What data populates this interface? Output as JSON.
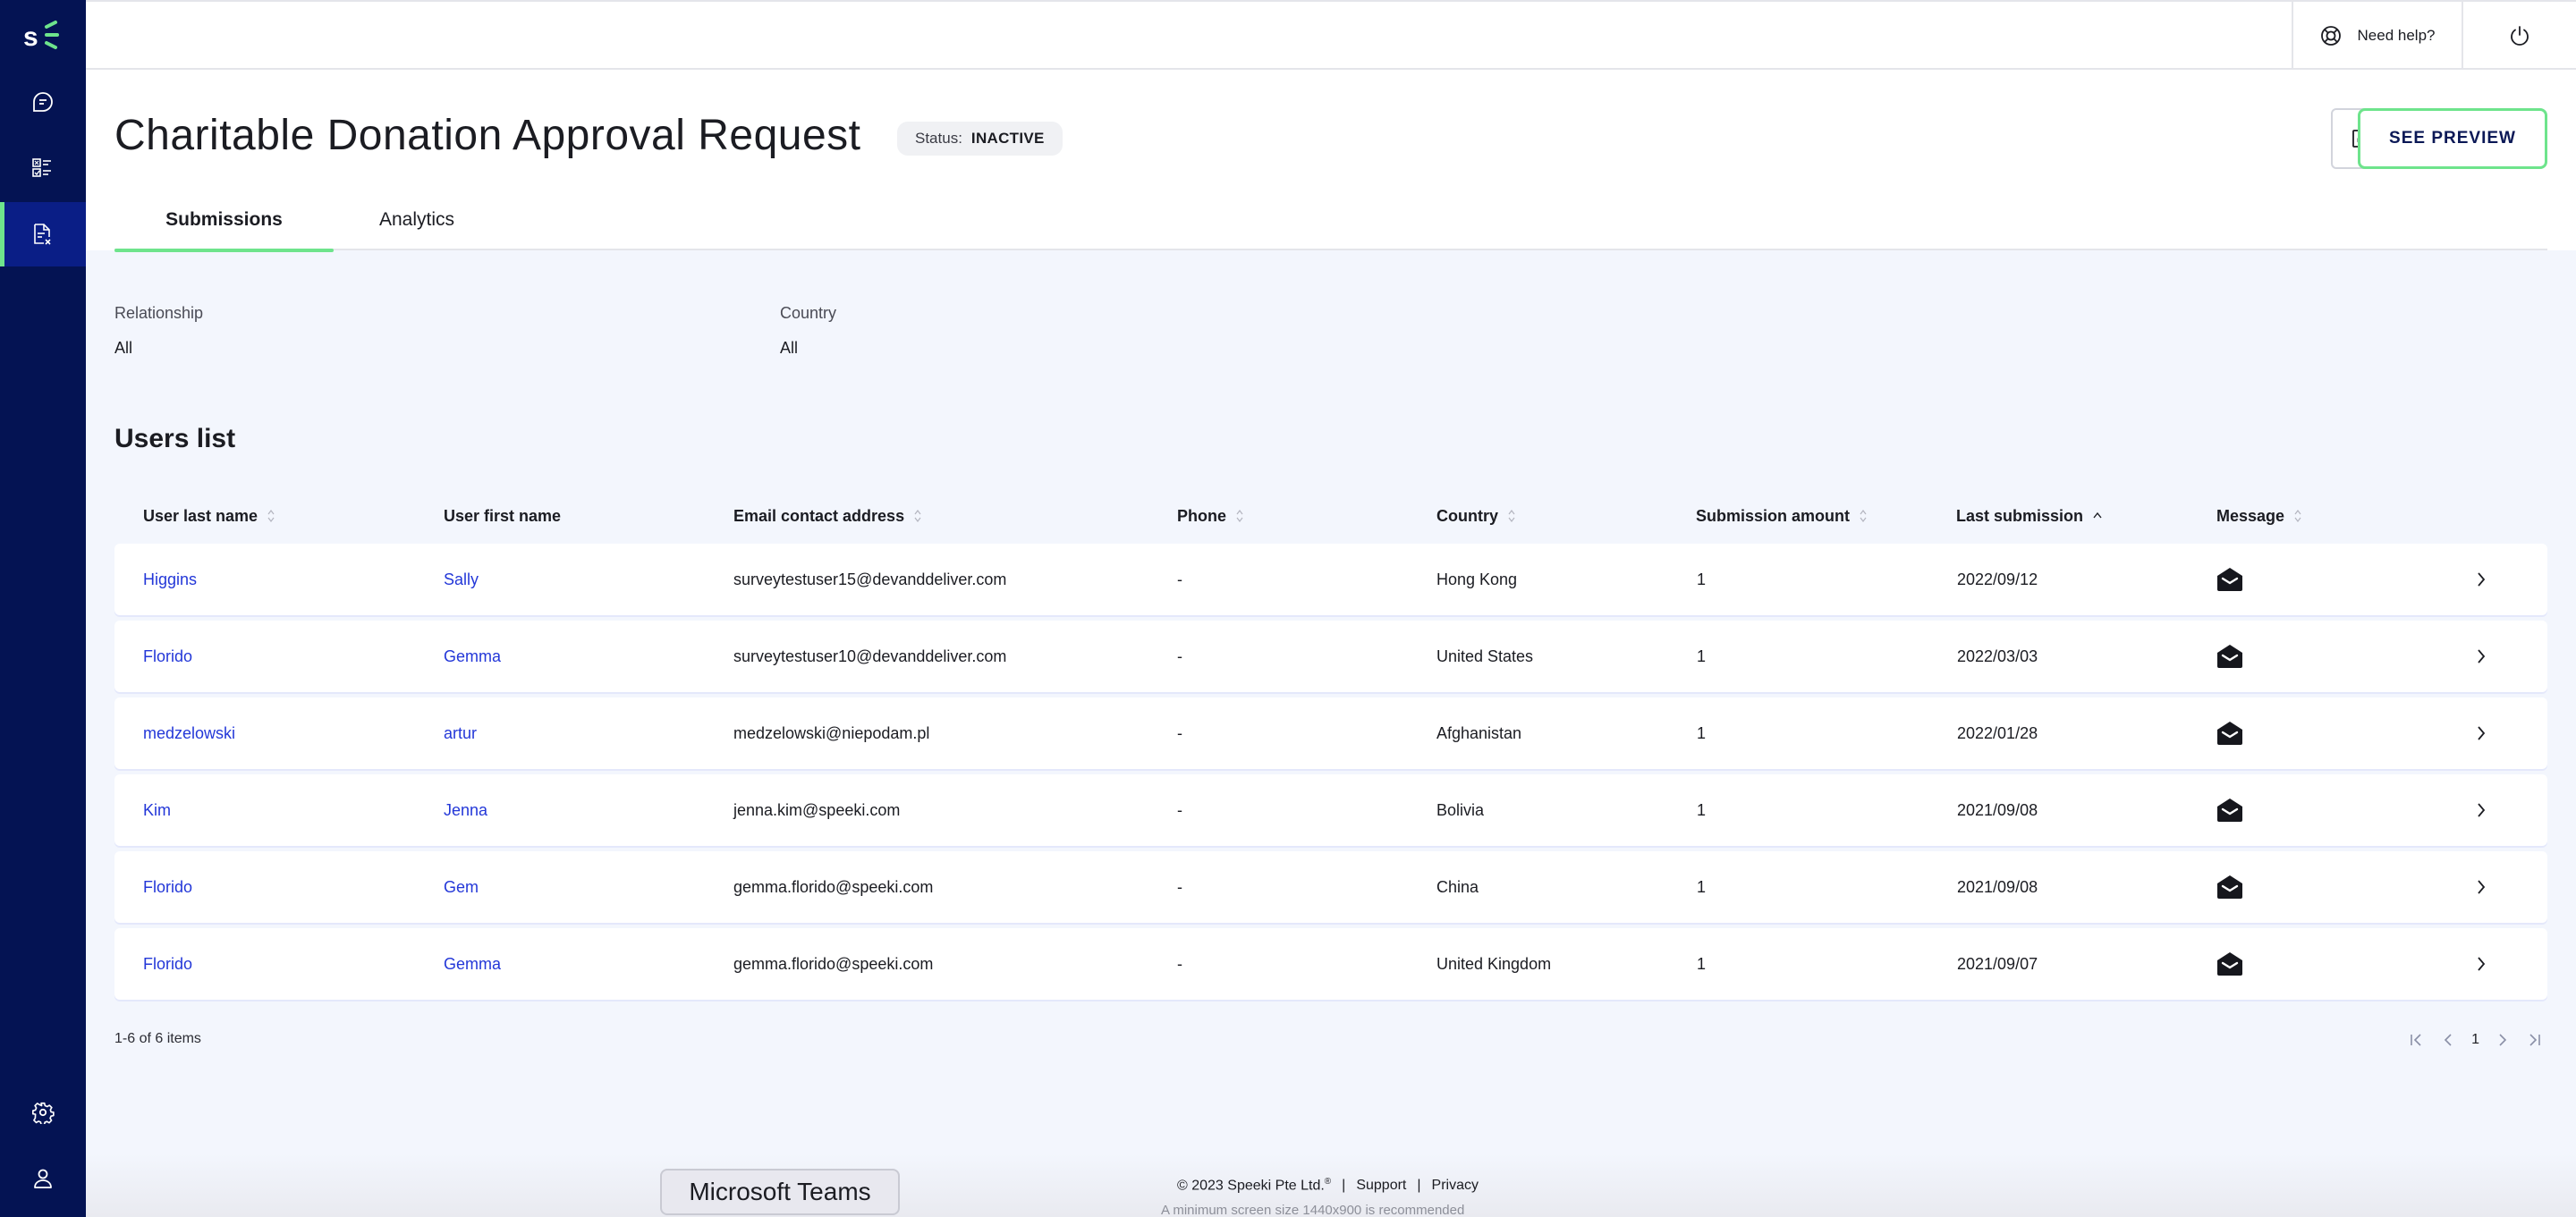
{
  "sidebar": {
    "logo": "speeki-logo",
    "items": [
      {
        "name": "chat",
        "icon": "chat-bubble-icon",
        "active": false
      },
      {
        "name": "checklist",
        "icon": "checklist-icon",
        "active": false
      },
      {
        "name": "forms",
        "icon": "document-icon",
        "active": true
      },
      {
        "name": "settings",
        "icon": "gear-icon",
        "active": false
      },
      {
        "name": "profile",
        "icon": "user-icon",
        "active": false
      }
    ]
  },
  "topbar": {
    "help_label": "Need help?",
    "help_icon": "lifebuoy-icon",
    "power_icon": "power-icon"
  },
  "header": {
    "title": "Charitable Donation Approval Request",
    "status_label": "Status:",
    "status_value": "INACTIVE",
    "edit_icon": "edit-icon",
    "preview_label": "SEE PREVIEW"
  },
  "tabs": [
    {
      "label": "Submissions",
      "active": true
    },
    {
      "label": "Analytics",
      "active": false
    }
  ],
  "filters": [
    {
      "label": "Relationship",
      "value": "All"
    },
    {
      "label": "Country",
      "value": "All"
    }
  ],
  "users_list": {
    "title": "Users list",
    "columns": [
      {
        "label": "User last name",
        "sort": "none"
      },
      {
        "label": "User first name",
        "sort": null
      },
      {
        "label": "Email contact address",
        "sort": "none"
      },
      {
        "label": "Phone",
        "sort": "none"
      },
      {
        "label": "Country",
        "sort": "none"
      },
      {
        "label": "Submission amount",
        "sort": "none"
      },
      {
        "label": "Last submission",
        "sort": "asc"
      },
      {
        "label": "Message",
        "sort": "none"
      }
    ],
    "rows": [
      {
        "last": "Higgins",
        "first": "Sally",
        "email": "surveytestuser15@devanddeliver.com",
        "phone": "-",
        "country": "Hong Kong",
        "amount": "1",
        "date": "2022/09/12",
        "message_icon": "envelope-open-icon"
      },
      {
        "last": "Florido",
        "first": "Gemma",
        "email": "surveytestuser10@devanddeliver.com",
        "phone": "-",
        "country": "United States",
        "amount": "1",
        "date": "2022/03/03",
        "message_icon": "envelope-open-icon"
      },
      {
        "last": "medzelowski",
        "first": "artur",
        "email": "medzelowski@niepodam.pl",
        "phone": "-",
        "country": "Afghanistan",
        "amount": "1",
        "date": "2022/01/28",
        "message_icon": "envelope-open-icon"
      },
      {
        "last": "Kim",
        "first": "Jenna",
        "email": "jenna.kim@speeki.com",
        "phone": "-",
        "country": "Bolivia",
        "amount": "1",
        "date": "2021/09/08",
        "message_icon": "envelope-open-icon"
      },
      {
        "last": "Florido",
        "first": "Gem",
        "email": "gemma.florido@speeki.com",
        "phone": "-",
        "country": "China",
        "amount": "1",
        "date": "2021/09/08",
        "message_icon": "envelope-open-icon"
      },
      {
        "last": "Florido",
        "first": "Gemma",
        "email": "gemma.florido@speeki.com",
        "phone": "-",
        "country": "United Kingdom",
        "amount": "1",
        "date": "2021/09/07",
        "message_icon": "envelope-open-icon"
      }
    ],
    "count_text": "1-6 of 6 items",
    "pagination": {
      "current_page": "1"
    }
  },
  "footer": {
    "copyright": "© 2023 Speeki Pte Ltd.",
    "registered": "®",
    "separator": "|",
    "support": "Support",
    "privacy": "Privacy",
    "note": "A minimum screen size 1440x900 is recommended"
  },
  "tooltip": {
    "text": "Microsoft Teams"
  },
  "colors": {
    "sidebar": "#041353",
    "sidebar_active": "#0a1e86",
    "accent_green": "#6ee48c",
    "link_blue": "#2337d8",
    "background": "#f3f6fd"
  }
}
